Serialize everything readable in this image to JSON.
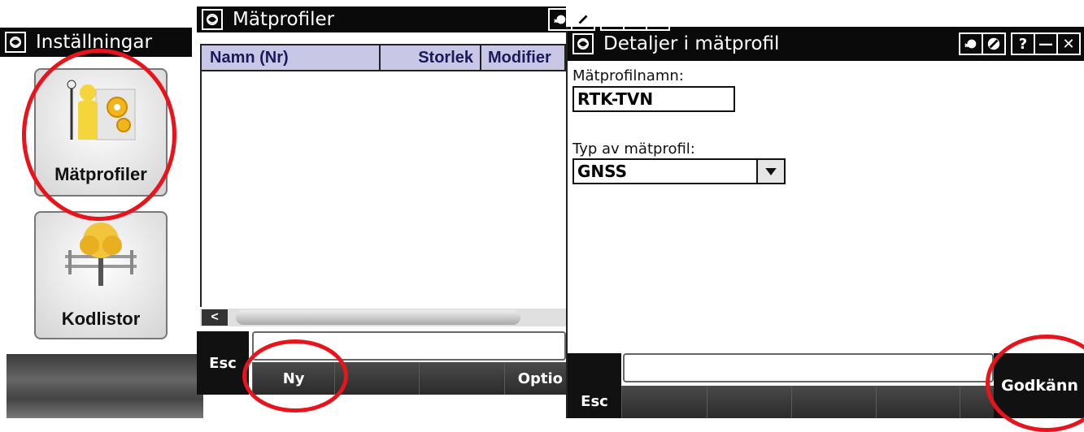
{
  "installningar": {
    "title": "Inställningar",
    "tiles": [
      {
        "label": "Mätprofiler",
        "icon": "surveyor-gears-icon"
      },
      {
        "label": "Kodlistor",
        "icon": "tree-fence-icon"
      }
    ]
  },
  "matprofiler": {
    "title": "Mätprofiler",
    "columns": [
      "Namn (Nr)",
      "Storlek",
      "Modifier"
    ],
    "softkeys": {
      "esc": "Esc",
      "ny": "Ny",
      "options": "Optio"
    }
  },
  "detaljer": {
    "title": "Detaljer i mätprofil",
    "name_label": "Mätprofilnamn:",
    "name_value": "RTK-TVN",
    "type_label": "Typ av mätprofil:",
    "type_value": "GNSS",
    "softkeys": {
      "esc": "Esc",
      "accept": "Godkänn"
    }
  },
  "titlebar_buttons": {
    "help": "?",
    "minimize": "—",
    "close": "✕"
  },
  "colors": {
    "header_bg": "#c8c8e6",
    "highlight": "#e8131b",
    "titlebar": "#0a0a0a"
  }
}
